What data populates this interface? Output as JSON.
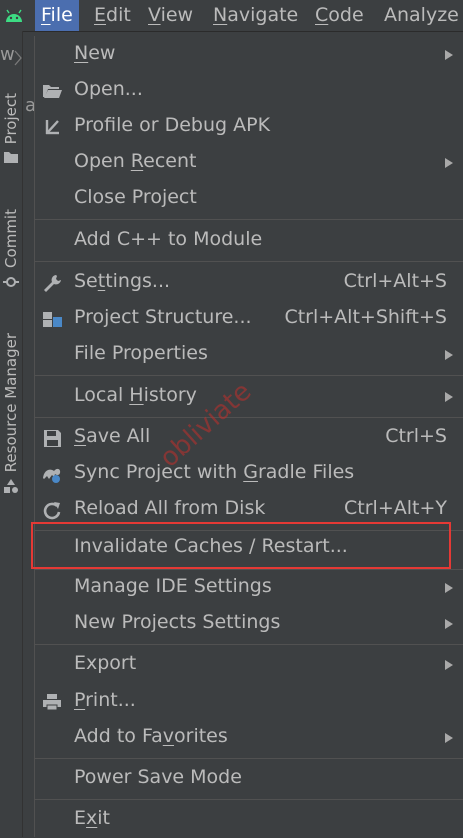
{
  "menubar": {
    "items": [
      {
        "mnemonic": "F",
        "rest": "ile",
        "active": true
      },
      {
        "mnemonic": "E",
        "rest": "dit"
      },
      {
        "mnemonic": "V",
        "rest": "iew"
      },
      {
        "mnemonic": "N",
        "rest": "avigate"
      },
      {
        "mnemonic": "C",
        "rest": "ode"
      },
      {
        "mnemonic": "",
        "rest": "Analyze"
      }
    ]
  },
  "left_strip": {
    "nav_fragment": "w",
    "editor_fragment": "a",
    "tabs": [
      "Project",
      "Commit",
      "Resource Manager"
    ]
  },
  "file_menu": {
    "items": [
      {
        "pre": "",
        "mn": "N",
        "post": "ew",
        "submenu": true
      },
      {
        "pre": "Open...",
        "mn": "",
        "post": "",
        "icon": "folder-open-icon"
      },
      {
        "pre": "Profile or Debug APK",
        "mn": "",
        "post": "",
        "icon": "profile-apk-icon"
      },
      {
        "pre": "Open ",
        "mn": "R",
        "post": "ecent",
        "submenu": true
      },
      {
        "pre": "Close Project",
        "mn": "",
        "post": ""
      },
      {
        "pre": "Add C++ to Module",
        "mn": "",
        "post": ""
      },
      {
        "pre": "Se",
        "mn": "t",
        "post": "tings...",
        "shortcut": "Ctrl+Alt+S",
        "icon": "wrench-icon"
      },
      {
        "pre": "Project Structure...",
        "mn": "",
        "post": "",
        "shortcut": "Ctrl+Alt+Shift+S",
        "icon": "project-structure-icon"
      },
      {
        "pre": "File Properties",
        "mn": "",
        "post": "",
        "submenu": true
      },
      {
        "pre": "Local ",
        "mn": "H",
        "post": "istory",
        "submenu": true
      },
      {
        "pre": "",
        "mn": "S",
        "post": "ave All",
        "shortcut": "Ctrl+S",
        "icon": "save-icon"
      },
      {
        "pre": "Sync Project with ",
        "mn": "G",
        "post": "radle Files",
        "icon": "gradle-sync-icon"
      },
      {
        "pre": "Reload All from Disk",
        "mn": "",
        "post": "",
        "shortcut": "Ctrl+Alt+Y",
        "icon": "reload-icon"
      },
      {
        "pre": "Invalidate Caches / Restart...",
        "mn": "",
        "post": ""
      },
      {
        "pre": "Manage IDE Settings",
        "mn": "",
        "post": "",
        "submenu": true
      },
      {
        "pre": "New Projects Settings",
        "mn": "",
        "post": "",
        "submenu": true
      },
      {
        "pre": "Export",
        "mn": "",
        "post": "",
        "submenu": true
      },
      {
        "pre": "",
        "mn": "P",
        "post": "rint...",
        "icon": "print-icon"
      },
      {
        "pre": "Add to Fa",
        "mn": "v",
        "post": "orites",
        "submenu": true
      },
      {
        "pre": "Power Save Mode",
        "mn": "",
        "post": ""
      },
      {
        "pre": "E",
        "mn": "x",
        "post": "it"
      }
    ]
  },
  "annotation": {
    "highlight_color": "#e53935",
    "watermark": "obliviate"
  }
}
